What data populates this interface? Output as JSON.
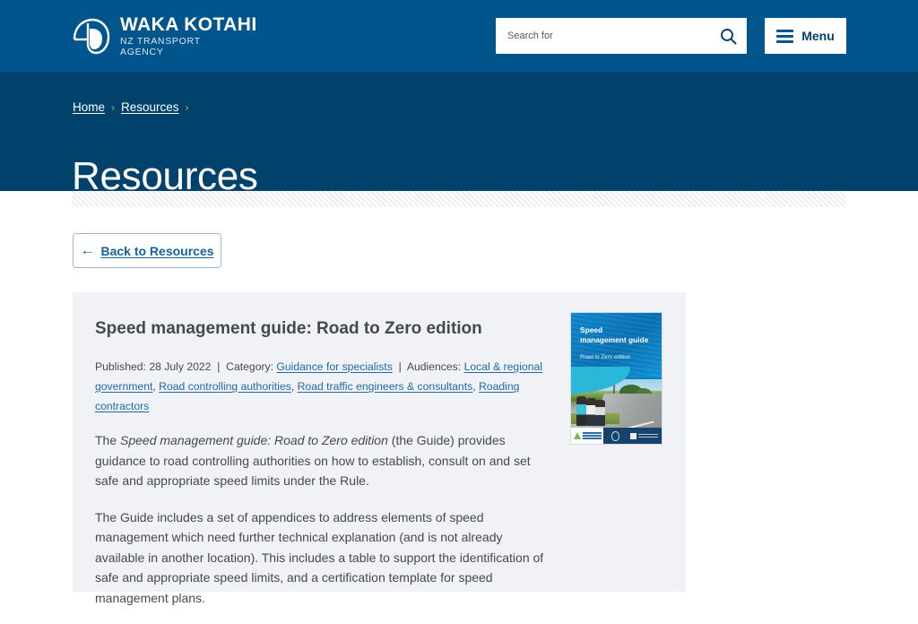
{
  "header": {
    "logo": {
      "primary": "WAKA KOTAHI",
      "secondary_line1": "NZ TRANSPORT",
      "secondary_line2": "AGENCY",
      "icon": "waka-kotahi-koru-logo"
    },
    "search": {
      "placeholder": "Search for",
      "value": "",
      "icon": "search-icon"
    },
    "menu": {
      "label": "Menu",
      "icon": "hamburger-icon"
    },
    "background_color": "#00558c"
  },
  "breadcrumb": {
    "items": [
      {
        "label": "Home"
      },
      {
        "label": "Resources"
      }
    ],
    "separator": "›",
    "separator_color": "#8cc63e",
    "background_color": "#00426c"
  },
  "page": {
    "title": "Resources"
  },
  "back_button": {
    "label": "Back to Resources",
    "arrow": "←",
    "icon": "arrow-left-icon",
    "accent_color": "#15629e"
  },
  "resource": {
    "title": "Speed management guide: Road to Zero edition",
    "meta": {
      "published_label": "Published:",
      "published_date": "28 July 2022",
      "divider": "|",
      "category_label": "Category:",
      "category": "Guidance for specialists",
      "audiences_label": "Audiences:",
      "audiences": [
        "Local & regional government",
        "Road controlling authorities",
        "Road traffic engineers & consultants",
        "Roading contractors"
      ]
    },
    "paragraph1": {
      "lead": "The ",
      "italic": "Speed management guide: Road to Zero edition",
      "rest": " (the Guide) provides guidance to road controlling authorities on how to establish, consult on and set safe and appropriate speed limits under the Rule."
    },
    "paragraph2": "The Guide includes a set of appendices to address elements of speed management which need further technical explanation (and is not already available in another location). This includes a table to support the identification of safe and appropriate speed limits, and a certification template for speed management plans.",
    "card_background": "#f1f2f6",
    "link_color": "#1d6aa8"
  },
  "cover": {
    "title": "Speed\nmanagement guide",
    "title_line1": "Speed",
    "title_line2": "management guide",
    "subtitle": "Road to Zero edition",
    "alt": "Speed management guide cover showing children walking along a rural road"
  }
}
